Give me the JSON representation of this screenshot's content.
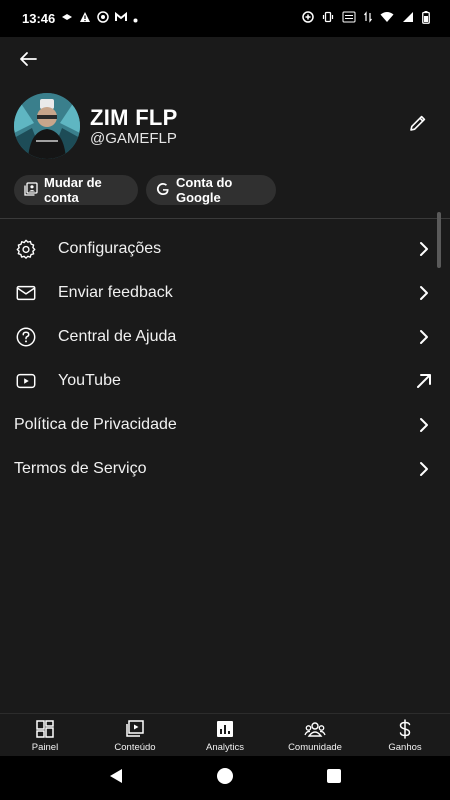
{
  "status_bar": {
    "time": "13:46"
  },
  "profile": {
    "name": "ZIM FLP",
    "handle": "@GAMEFLP"
  },
  "chips": {
    "switch_account": "Mudar de conta",
    "google_account": "Conta do Google"
  },
  "menu": {
    "settings": "Configurações",
    "feedback": "Enviar feedback",
    "help": "Central de Ajuda",
    "youtube": "YouTube",
    "privacy": "Política de Privacidade",
    "terms": "Termos de Serviço"
  },
  "bottom_nav": {
    "dashboard": "Painel",
    "content": "Conteúdo",
    "analytics": "Analytics",
    "community": "Comunidade",
    "earn": "Ganhos"
  },
  "colors": {
    "background": "#1a1a1a",
    "chip": "#303030",
    "text": "#f1f1f1"
  }
}
